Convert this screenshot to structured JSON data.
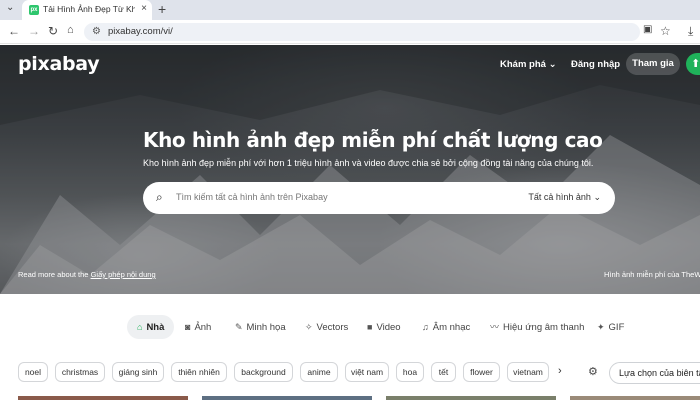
{
  "browser": {
    "tab_title": "Tải Hình Ảnh Đẹp Từ Kho Hình",
    "url": "pixabay.com/vi/"
  },
  "header": {
    "logo": "pixabay",
    "explore": "Khám phá",
    "login": "Đăng nhập",
    "join": "Tham gia"
  },
  "hero": {
    "title": "Kho hình ảnh đẹp miễn phí chất lượng cao",
    "subtitle": "Kho hình ảnh đẹp miễn phí với hơn 1 triệu hình ảnh và video được chia sẻ bởi cộng đồng tài năng của chúng tôi.",
    "search_placeholder": "Tìm kiếm tất cả hình ảnh trên Pixabay",
    "search_filter": "Tất cả hình ảnh",
    "license_prefix": "Read more about the",
    "license_link": "Giấy phép nội dung",
    "credit": "Hình ảnh miễn phí của TheWa"
  },
  "categories": [
    {
      "icon": "home-icon",
      "label": "Nhà"
    },
    {
      "icon": "camera-icon",
      "label": "Ảnh"
    },
    {
      "icon": "pen-icon",
      "label": "Minh họa"
    },
    {
      "icon": "vector-icon",
      "label": "Vectors"
    },
    {
      "icon": "video-icon",
      "label": "Video"
    },
    {
      "icon": "music-icon",
      "label": "Âm nhạc"
    },
    {
      "icon": "sound-wave-icon",
      "label": "Hiệu ứng âm thanh"
    },
    {
      "icon": "gif-icon",
      "label": "GIF"
    }
  ],
  "tags": [
    "noel",
    "christmas",
    "giáng sinh",
    "thiên nhiên",
    "background",
    "anime",
    "việt nam",
    "hoa",
    "tết",
    "flower",
    "vietnam"
  ],
  "choose_label": "Lựa chọn của biên tập",
  "colors": {
    "accent": "#1fb25a",
    "hero_bg": "#5a5f64"
  }
}
